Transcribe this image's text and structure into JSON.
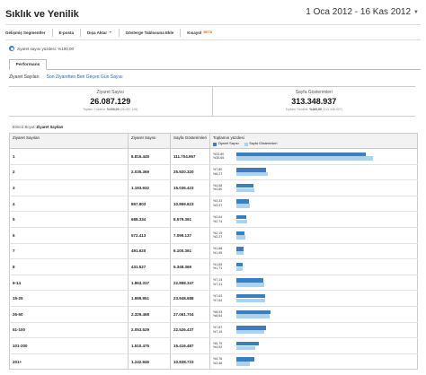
{
  "header": {
    "title": "Sıklık ve Yenilik",
    "date_range": "1 Oca 2012 - 16 Kas 2012"
  },
  "toolbar": {
    "advanced_segments": "Gelişmiş Segmentler",
    "email": "E-posta",
    "export": "Dışa Aktar",
    "add_to_dashboard": "Gösterge Tablosuna Ekle",
    "shortcut": "Kısayol",
    "beta": "BETA"
  },
  "segment": {
    "label": "ziyaret sayısı yüzdesi: %100,00"
  },
  "tabs": {
    "active": "Performans"
  },
  "subtabs": {
    "current": "Ziyaret Sayıları",
    "link": "Son Ziyaretten Beri Geçen Gün Sayısı"
  },
  "summary": [
    {
      "label": "Ziyaret Sayısı",
      "value": "26.087.129",
      "sub_label": "Toplam Yüzdesi:",
      "sub_value": "%100,00",
      "sub_total": "(26.087.129)"
    },
    {
      "label": "Sayfa Gösterimleri",
      "value": "313.348.937",
      "sub_label": "Toplam Yüzdesi:",
      "sub_value": "%100,00",
      "sub_total": "(313.348.937)"
    }
  ],
  "primary_dimension": {
    "label": "Birincil Boyut:",
    "value": "Ziyaret Sayıları"
  },
  "table": {
    "headers": [
      "Ziyaret Sayıları",
      "Ziyaret Sayısı",
      "Sayfa Gösterimleri",
      "Toplamın yüzdesi"
    ],
    "legend": [
      "Ziyaret Sayısı",
      "Sayfa Gösterimleri"
    ],
    "colors": {
      "visits": "#3a7fc1",
      "pageviews": "#a9d3f2"
    },
    "rows": [
      {
        "label": "1",
        "visits": "8.816.445",
        "pageviews": "111.704.957",
        "visits_pct_text": "%33,80",
        "pv_pct_text": "%35,65",
        "visits_pct": 33.8,
        "pv_pct": 35.65
      },
      {
        "label": "2",
        "visits": "2.035.369",
        "pageviews": "25.920.320",
        "visits_pct_text": "%7,80",
        "pv_pct_text": "%8,27",
        "visits_pct": 7.8,
        "pv_pct": 8.27
      },
      {
        "label": "3",
        "visits": "1.193.932",
        "pageviews": "15.036.423",
        "visits_pct_text": "%4,58",
        "pv_pct_text": "%4,80",
        "visits_pct": 4.58,
        "pv_pct": 4.8
      },
      {
        "label": "4",
        "visits": "867.803",
        "pageviews": "10.869.623",
        "visits_pct_text": "%3,33",
        "pv_pct_text": "%3,47",
        "visits_pct": 3.33,
        "pv_pct": 3.47
      },
      {
        "label": "5",
        "visits": "688.334",
        "pageviews": "8.579.361",
        "visits_pct_text": "%2,64",
        "pv_pct_text": "%2,74",
        "visits_pct": 2.64,
        "pv_pct": 2.74
      },
      {
        "label": "6",
        "visits": "572.413",
        "pageviews": "7.099.137",
        "visits_pct_text": "%2,19",
        "pv_pct_text": "%2,27",
        "visits_pct": 2.19,
        "pv_pct": 2.27
      },
      {
        "label": "7",
        "visits": "491.620",
        "pageviews": "6.100.361",
        "visits_pct_text": "%1,88",
        "pv_pct_text": "%1,95",
        "visits_pct": 1.88,
        "pv_pct": 1.95
      },
      {
        "label": "8",
        "visits": "431.527",
        "pageviews": "5.348.369",
        "visits_pct_text": "%1,65",
        "pv_pct_text": "%1,71",
        "visits_pct": 1.65,
        "pv_pct": 1.71
      },
      {
        "label": "9-14",
        "visits": "1.863.317",
        "pageviews": "22.898.347",
        "visits_pct_text": "%7,14",
        "pv_pct_text": "%7,31",
        "visits_pct": 7.14,
        "pv_pct": 7.31
      },
      {
        "label": "15-25",
        "visits": "1.989.951",
        "pageviews": "23.948.688",
        "visits_pct_text": "%7,63",
        "pv_pct_text": "%7,64",
        "visits_pct": 7.63,
        "pv_pct": 7.64
      },
      {
        "label": "26-50",
        "visits": "2.329.468",
        "pageviews": "27.061.704",
        "visits_pct_text": "%8,93",
        "pv_pct_text": "%8,64",
        "visits_pct": 8.93,
        "pv_pct": 8.64
      },
      {
        "label": "51-100",
        "visits": "2.053.529",
        "pageviews": "22.526.437",
        "visits_pct_text": "%7,87",
        "pv_pct_text": "%7,19",
        "visits_pct": 7.87,
        "pv_pct": 7.19
      },
      {
        "label": "101-200",
        "visits": "1.510.475",
        "pageviews": "15.416.487",
        "visits_pct_text": "%5,79",
        "pv_pct_text": "%4,92",
        "visits_pct": 5.79,
        "pv_pct": 4.92
      },
      {
        "label": "201+",
        "visits": "1.242.946",
        "pageviews": "10.838.723",
        "visits_pct_text": "%4,76",
        "pv_pct_text": "%3,46",
        "visits_pct": 4.76,
        "pv_pct": 3.46
      }
    ]
  }
}
